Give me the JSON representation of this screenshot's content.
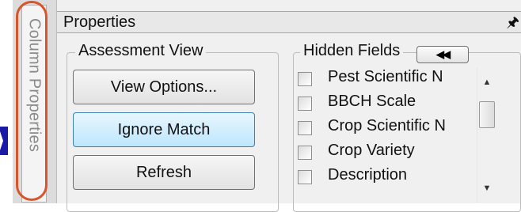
{
  "side_tab": {
    "label": "Column Properties"
  },
  "panel": {
    "title": "Properties",
    "pin_icon": "pin-icon"
  },
  "assessment_view": {
    "label": "Assessment View",
    "buttons": [
      {
        "label": "View Options..."
      },
      {
        "label": "Ignore Match",
        "state": "hovered"
      },
      {
        "label": "Refresh"
      }
    ]
  },
  "hidden_fields": {
    "label": "Hidden Fields",
    "collapse_icon": "double-left-arrow-icon",
    "items": [
      {
        "label": "Pest Scientific N",
        "checked": false
      },
      {
        "label": "BBCH Scale",
        "checked": false
      },
      {
        "label": "Crop Scientific N",
        "checked": false
      },
      {
        "label": "Crop Variety",
        "checked": false
      },
      {
        "label": "Description",
        "checked": false
      }
    ]
  },
  "colors": {
    "highlight_oval": "#d9532b",
    "hover_button": "#bee6fd",
    "arrow": "#1a1aa6"
  }
}
